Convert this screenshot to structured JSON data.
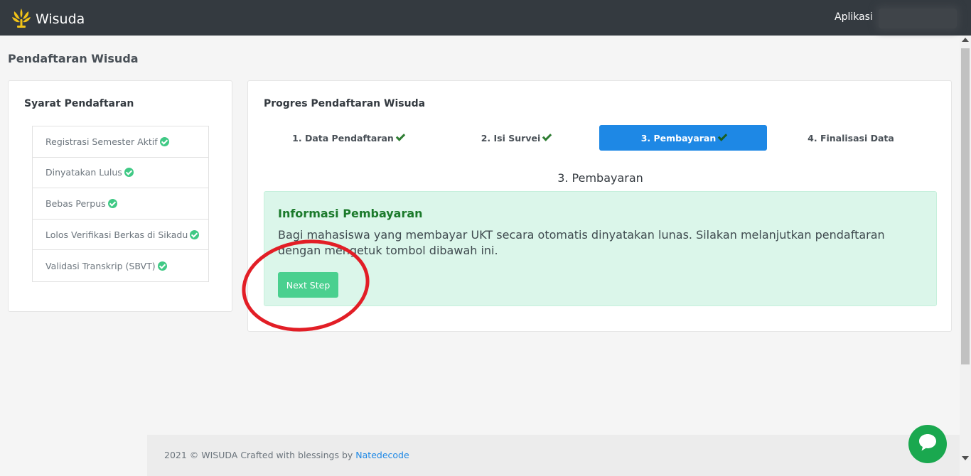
{
  "navbar": {
    "brand": "Wisuda",
    "logo_icon": "university-logo-icon",
    "apps_label": "Aplikasi"
  },
  "page": {
    "title": "Pendaftaran Wisuda"
  },
  "requirements": {
    "title": "Syarat Pendaftaran",
    "items": [
      {
        "label": "Registrasi Semester Aktif",
        "status": "complete"
      },
      {
        "label": "Dinyatakan Lulus",
        "status": "complete"
      },
      {
        "label": "Bebas Perpus",
        "status": "complete"
      },
      {
        "label": "Lolos Verifikasi Berkas di Sikadu",
        "status": "complete"
      },
      {
        "label": "Validasi Transkrip (SBVT)",
        "status": "complete"
      }
    ]
  },
  "progress": {
    "title": "Progres Pendaftaran Wisuda",
    "steps": [
      {
        "label": "1. Data Pendaftaran",
        "done": true,
        "active": false
      },
      {
        "label": "2. Isi Survei",
        "done": true,
        "active": false
      },
      {
        "label": "3. Pembayaran",
        "done": true,
        "active": true
      },
      {
        "label": "4. Finalisasi Data",
        "done": false,
        "active": false
      }
    ],
    "current_heading": "3. Pembayaran"
  },
  "payment_alert": {
    "title": "Informasi Pembayaran",
    "text": "Bagi mahasiswa yang membayar UKT secara otomatis dinyatakan lunas. Silakan melanjutkan pendaftaran dengan mengetuk tombol dibawah ini.",
    "button_label": "Next Step"
  },
  "footer": {
    "text": "2021 © WISUDA Crafted with blessings by",
    "link": "Natedecode"
  },
  "colors": {
    "navbar": "#343a40",
    "active_step": "#1e88e5",
    "alert_bg": "#dbf6ea",
    "button": "#4ad08f",
    "annotation": "#e21e26",
    "chat": "#1aa84f"
  }
}
